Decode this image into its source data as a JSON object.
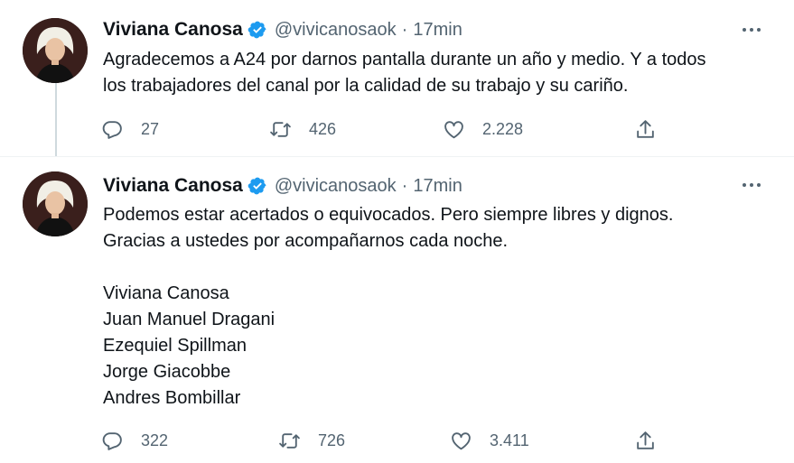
{
  "tweets": [
    {
      "name": "Viviana Canosa",
      "handle": "@vivicanosaok",
      "separator": "·",
      "time": "17min",
      "text": [
        "Agradecemos a A24 por darnos pantalla durante un año y medio. Y a todos",
        "los trabajadores del canal por la calidad de su trabajo y su cariño."
      ],
      "replies": "27",
      "retweets": "426",
      "likes": "2.228"
    },
    {
      "name": "Viviana Canosa",
      "handle": "@vivicanosaok",
      "separator": "·",
      "time": "17min",
      "text": [
        "Podemos estar acertados o equivocados. Pero siempre libres y dignos.",
        "Gracias a ustedes por acompañarnos cada noche.",
        "",
        "Viviana Canosa",
        "Juan Manuel Dragani",
        "Ezequiel Spillman",
        "Jorge Giacobbe",
        "Andres Bombillar"
      ],
      "replies": "322",
      "retweets": "726",
      "likes": "3.411"
    }
  ],
  "colors": {
    "verified": "#1d9bf0",
    "secondary_text": "#536471",
    "primary_text": "#0f1419",
    "thread_line": "#cfd9de"
  },
  "icons": {
    "verified": "verified-badge-icon",
    "more": "more-dots-icon",
    "reply": "reply-icon",
    "retweet": "retweet-icon",
    "like": "heart-icon",
    "share": "share-icon"
  }
}
